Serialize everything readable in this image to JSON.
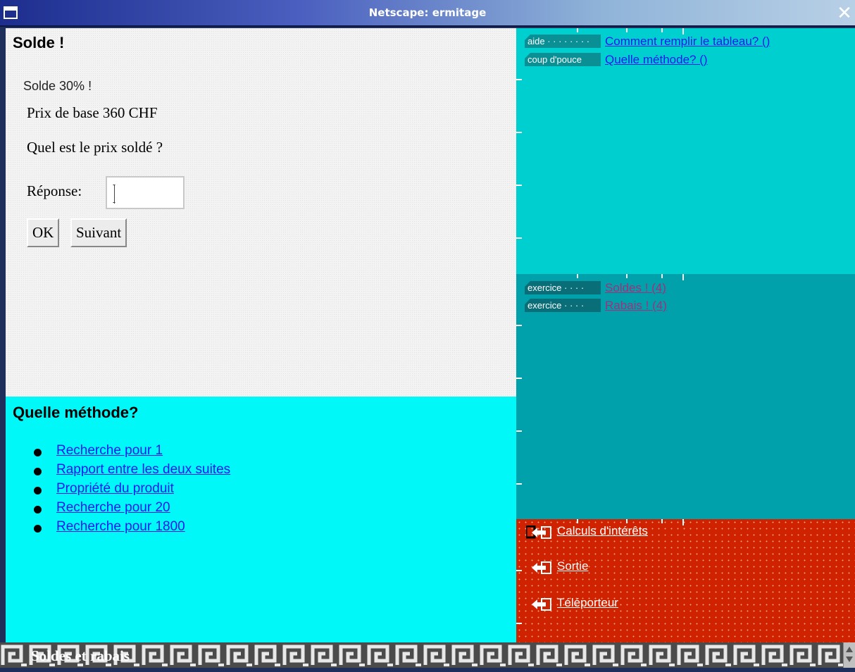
{
  "window": {
    "title": "Netscape: ermitage"
  },
  "exercise": {
    "heading": "Solde !",
    "subtitle": "Solde 30% !",
    "base_price": "Prix de base 360 CHF",
    "question": "Quel est le prix soldé ?",
    "answer_label": "Réponse:",
    "answer_value": "",
    "ok_label": "OK",
    "next_label": "Suivant"
  },
  "method": {
    "heading": "Quelle méthode?",
    "items": [
      {
        "label": "Recherche pour 1"
      },
      {
        "label": "Rapport entre les deux suites"
      },
      {
        "label": "Propriété du produit"
      },
      {
        "label": "Recherche pour 20"
      },
      {
        "label": "Recherche pour 1800"
      }
    ]
  },
  "help": {
    "items": [
      {
        "tag": "aide · · · · · · · ·",
        "label": "Comment remplir le tableau? ()"
      },
      {
        "tag": "coup d'pouce",
        "label": "Quelle méthode? ()"
      }
    ]
  },
  "exercises": {
    "items": [
      {
        "tag": "exercice · · · ·",
        "label": "Soldes ! (4)"
      },
      {
        "tag": "exercice · · · ·",
        "label": "Rabais ! (4)"
      }
    ]
  },
  "navigation": {
    "items": [
      {
        "label": "Calculs d'intérêts"
      },
      {
        "label": "Sortie"
      },
      {
        "label": "Téléporteur"
      }
    ]
  },
  "banner": {
    "title": "Soldes et rabais"
  },
  "colors": {
    "exercise_bg": "#f3f3f3",
    "method_bg": "#00f8f8",
    "help_bg": "#00cfcf",
    "exlist_bg": "#00a1ab",
    "nav_bg": "#cf2200",
    "link_blue": "#1a1aee",
    "link_visited": "#a0307a"
  }
}
